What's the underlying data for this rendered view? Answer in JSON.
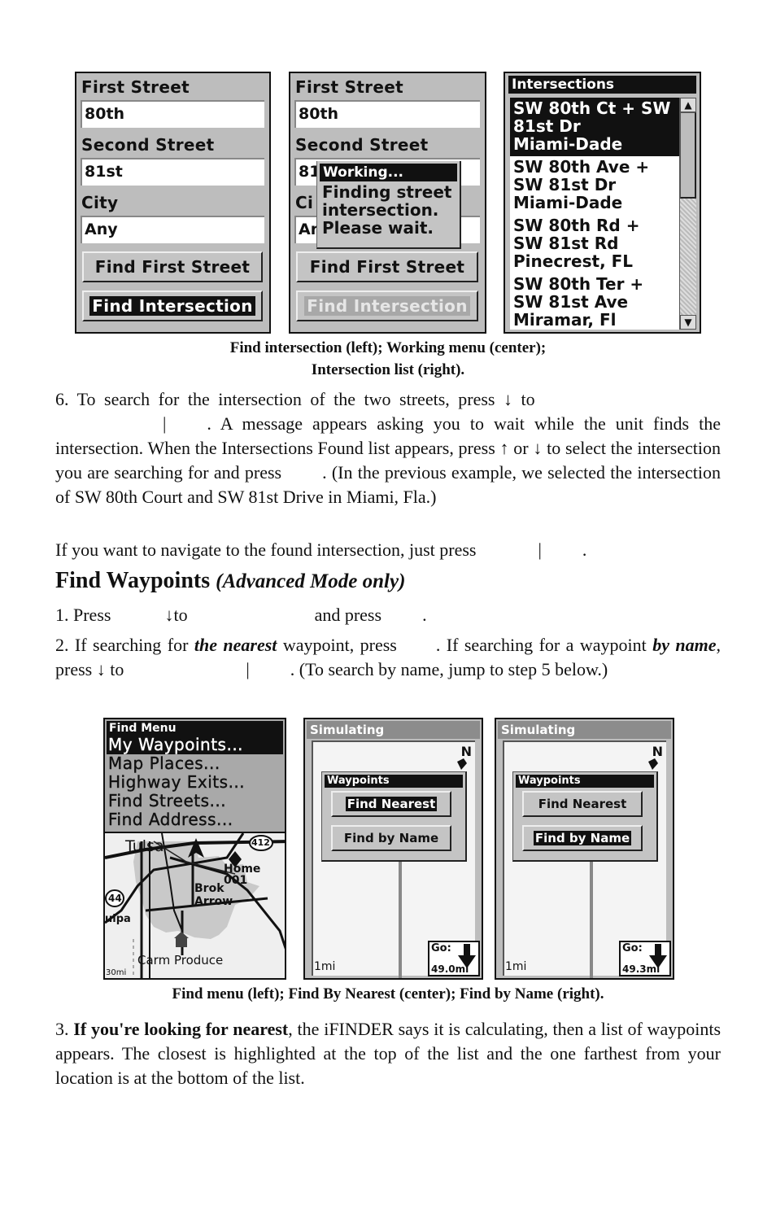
{
  "top_figures": {
    "left": {
      "first_street_label": "First Street",
      "first_street_value": "80th",
      "second_street_label": "Second Street",
      "second_street_value": "81st",
      "city_label": "City",
      "city_value": "Any",
      "find_first_street_button": "Find First Street",
      "find_intersection_button": "Find Intersection"
    },
    "center": {
      "first_street_label": "First Street",
      "first_street_value": "80th",
      "second_street_label": "Second Street",
      "second_street_value_partial": "81",
      "city_label_partial": "Ci",
      "city_value_partial": "Ar",
      "popup_title": "Working...",
      "popup_lines": [
        "Finding street",
        "intersection.",
        "Please wait."
      ],
      "find_first_street_button": "Find First Street",
      "find_intersection_button": "Find Intersection"
    },
    "right": {
      "header": "Intersections",
      "items": [
        {
          "lines": [
            "SW 80th Ct + SW",
            "81st Dr",
            "Miami-Dade"
          ],
          "selected": true
        },
        {
          "lines": [
            "SW 80th Ave +",
            "SW 81st Dr",
            "Miami-Dade"
          ],
          "selected": false
        },
        {
          "lines": [
            "SW 80th Rd +",
            "SW 81st Rd",
            "Pinecrest, FL"
          ],
          "selected": false
        },
        {
          "lines": [
            "SW 80th Ter +",
            "SW 81st Ave",
            "Miramar, Fl"
          ],
          "selected": false
        }
      ],
      "scroll_up_glyph": "▲",
      "scroll_down_glyph": "▼"
    },
    "caption_line1": "Find intersection (left); Working menu (center);",
    "caption_line2": "Intersection list (right)."
  },
  "step6": {
    "line1_a": "6. To search for the intersection of the two streets, press",
    "down_arrow": "↓",
    "line1_b": "to",
    "pipe": "|",
    "line2": ". A message appears asking you to wait while the unit finds the intersection. When the Intersections Found list appears, press",
    "up_arrow": "↑",
    "or": "or",
    "line3": "to select the intersection you are searching for and press",
    "line4": ". (In the previous example, we selected the intersection of SW 80th Court and SW 81st Drive in Miami, Fla.)"
  },
  "navigate_para": {
    "text": "If you want to navigate to the found intersection, just press",
    "pipe": "|",
    "end": "."
  },
  "section": {
    "title": "Find Waypoints",
    "qualifier": "(Advanced Mode only)"
  },
  "step1": {
    "a": "1. Press",
    "arrow": "↓",
    "b": "to",
    "c": "and press",
    "d": "."
  },
  "step2": {
    "a": "2. If searching for",
    "b_emph": "the nearest",
    "c": "waypoint, press",
    "d": ". If searching for a waypoint",
    "e_emph": "by name",
    "f": ", press",
    "arrow": "↓",
    "g": "to",
    "pipe": "|",
    "h": ". (To search by name, jump to step 5 below.)"
  },
  "bottom_figures": {
    "left": {
      "menu_title": "Find Menu",
      "items": [
        "My Waypoints...",
        "Map Places...",
        "Highway Exits...",
        "Find Streets...",
        "Find Address..."
      ],
      "selected_index": 0,
      "map_labels": {
        "city1": "Tulsa",
        "city2_line1": "Brok",
        "city2_line2": "Arrow",
        "city3": "ulpa",
        "poi": "Carm Produce",
        "waypoint_name": "Home",
        "waypoint_num": "001",
        "highway1": "412",
        "highway2": "44",
        "scale": "30mi"
      }
    },
    "center": {
      "title": "Simulating",
      "north": "N",
      "popup_title": "Waypoints",
      "button1": "Find Nearest",
      "button2": "Find by Name",
      "selected": "Find Nearest",
      "scale": "1mi",
      "go_label": "Go:",
      "go_distance": "49.0mi"
    },
    "right": {
      "title": "Simulating",
      "north": "N",
      "popup_title": "Waypoints",
      "button1": "Find Nearest",
      "button2": "Find by Name",
      "selected": "Find by Name",
      "scale": "1mi",
      "go_label": "Go:",
      "go_distance": "49.3mi"
    },
    "caption": "Find menu (left); Find By Nearest (center); Find by Name (right)."
  },
  "step3": {
    "a": "3.",
    "b_bold": "If you're looking for nearest",
    "c": ", the iFINDER says it is calculating, then a list of waypoints appears. The closest is highlighted at the top of the list and the one farthest from your location is at the bottom of the list."
  }
}
